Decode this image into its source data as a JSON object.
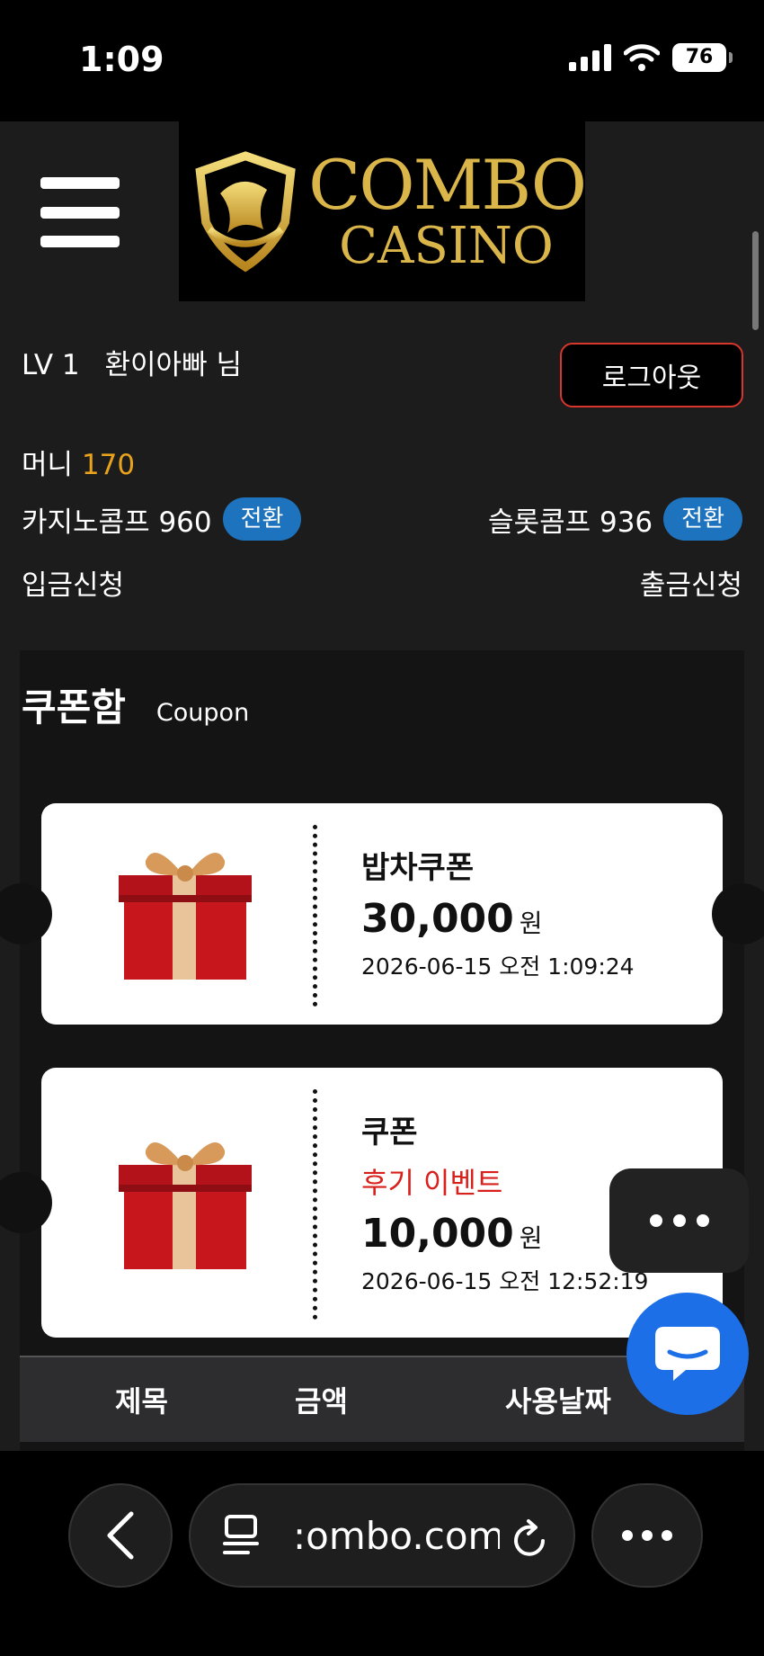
{
  "status_bar": {
    "time": "1:09",
    "battery": "76"
  },
  "header": {
    "logo_line1": "COMBO",
    "logo_line2": "CASINO"
  },
  "user": {
    "level": "LV 1",
    "name": "환이아빠 님",
    "logout_label": "로그아웃",
    "money_label": "머니",
    "money_value": "170",
    "casino_comp_label": "카지노콤프 960",
    "slot_comp_label": "슬롯콤프 936",
    "convert_label": "전환",
    "deposit_label": "입금신청",
    "withdraw_label": "출금신청"
  },
  "coupon_box": {
    "title_ko": "쿠폰함",
    "title_en": "Coupon",
    "coupons": [
      {
        "name": "밥차쿠폰",
        "event": "",
        "amount": "30,000",
        "currency": "원",
        "date": "2026-06-15 오전 1:09:24"
      },
      {
        "name": "쿠폰",
        "event": "후기 이벤트",
        "amount": "10,000",
        "currency": "원",
        "date": "2026-06-15 오전 12:52:19"
      }
    ],
    "table_headers": [
      "제목",
      "금액",
      "사용날짜"
    ]
  },
  "browser": {
    "url": ":ombo.com"
  },
  "colors": {
    "accent_blue": "#1e73be",
    "money_orange": "#e8a21c",
    "logout_red": "#d8352c",
    "event_red": "#d8201c",
    "chat_blue": "#1c6fe6",
    "logo_gold": "#d9b54a"
  },
  "icons": [
    "signal-icon",
    "wifi-icon",
    "battery-icon",
    "hamburger-icon",
    "gift-icon",
    "more-icon",
    "chat-icon",
    "back-icon",
    "tabs-icon",
    "reload-icon"
  ]
}
